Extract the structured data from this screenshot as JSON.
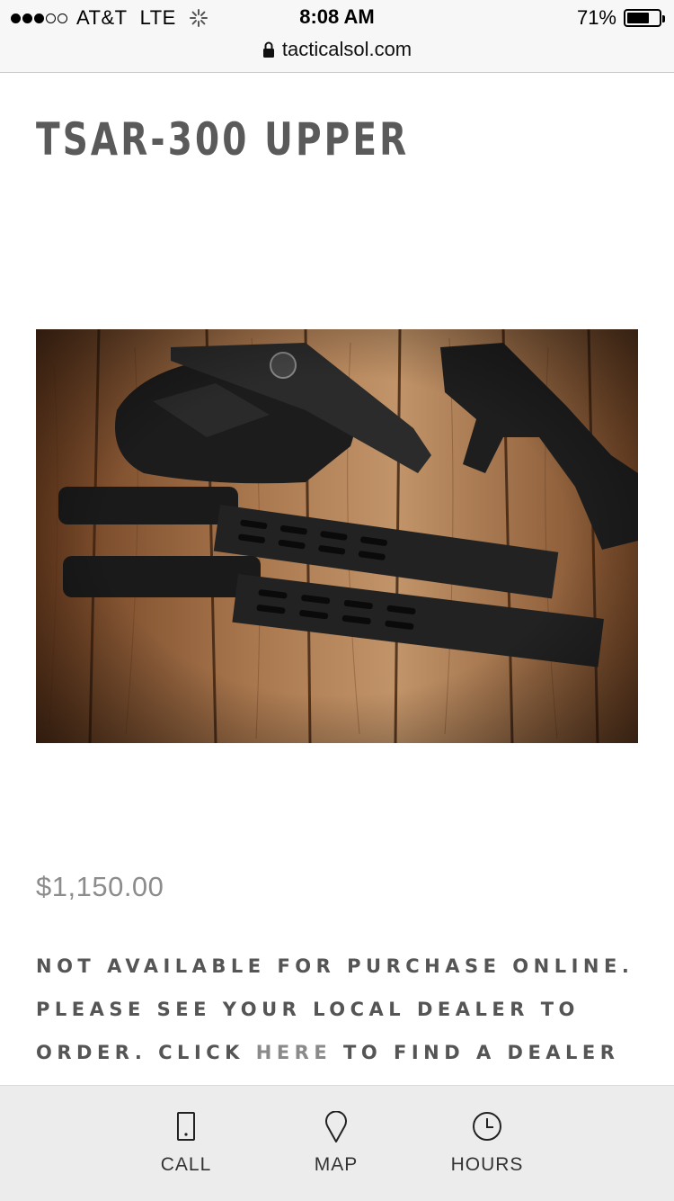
{
  "status_bar": {
    "signal": "●●●○○",
    "carrier": "AT&T",
    "network": "LTE",
    "time": "8:08 AM",
    "battery_percent": "71%",
    "battery_level": 0.71
  },
  "url_bar": {
    "url": "tacticalsol.com",
    "icon": "lock-icon"
  },
  "product": {
    "title": "TSAR-300 UPPER",
    "price": "$1,150.00",
    "image_icon": "product-photo"
  },
  "notice": {
    "text_before": "NOT AVAILABLE FOR PURCHASE ONLINE. PLEASE SEE YOUR LOCAL DEALER TO ORDER. CLICK ",
    "link_text": "HERE",
    "text_after": " TO FIND A DEALER IN YOUR AREA."
  },
  "bottom_nav": {
    "items": [
      {
        "label": "CALL",
        "icon": "phone-icon"
      },
      {
        "label": "MAP",
        "icon": "map-pin-icon"
      },
      {
        "label": "HOURS",
        "icon": "clock-icon"
      }
    ]
  },
  "colors": {
    "title": "#5a5a5a",
    "price": "#8c8c8c",
    "link": "#8a8a8a",
    "nav_bg": "#ececec"
  }
}
